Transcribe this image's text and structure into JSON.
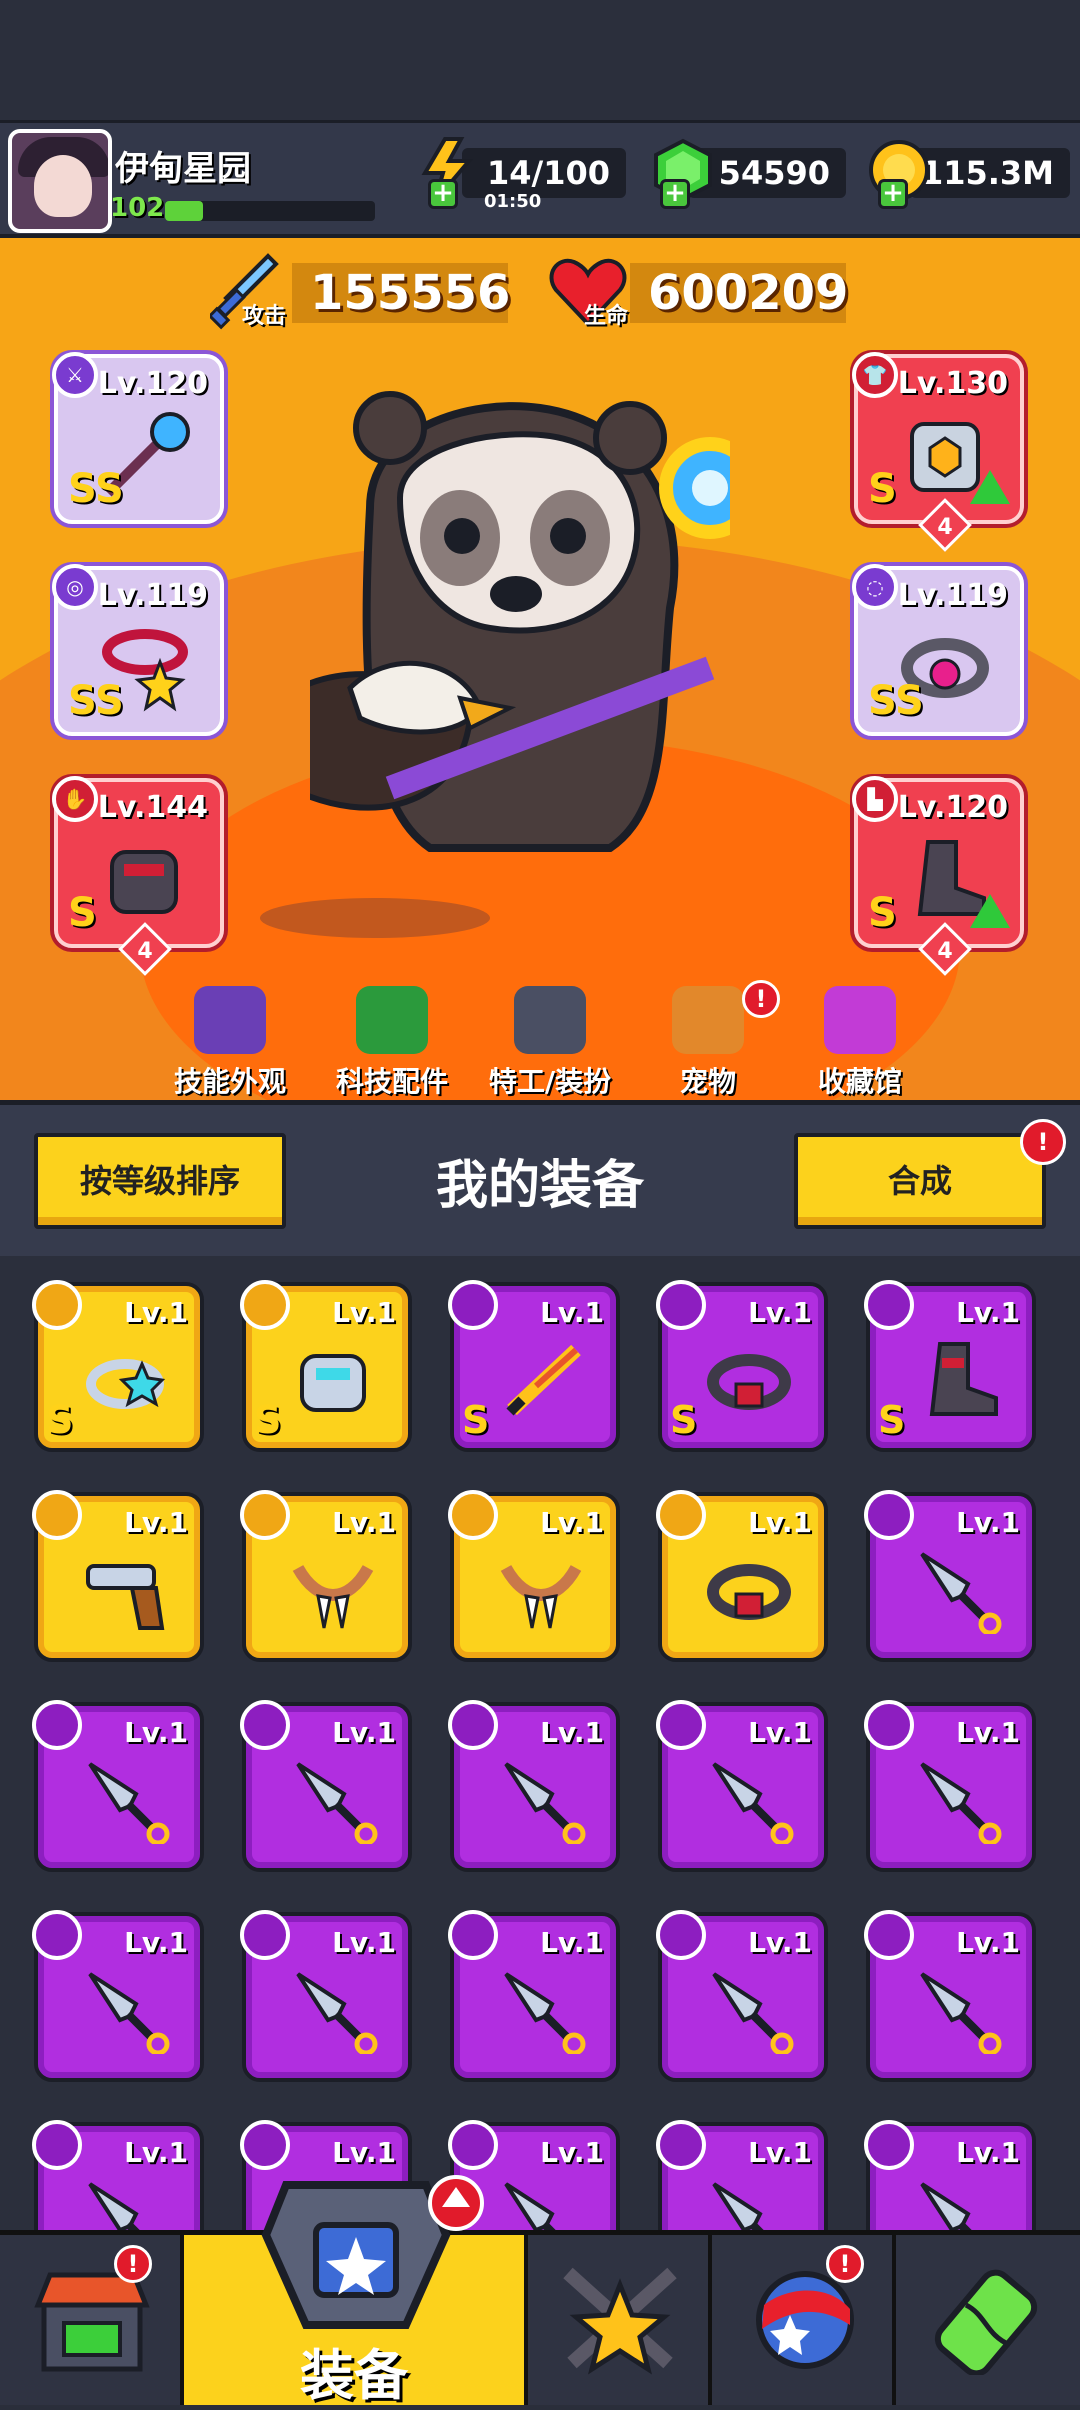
{
  "header": {
    "player_name": "伊甸星园",
    "level": "102",
    "xp_fraction": 0.18,
    "energy": "14/100",
    "energy_timer": "01:50",
    "gems": "54590",
    "coins": "115.3M"
  },
  "stats": {
    "attack_label": "攻击",
    "attack_value": "155556",
    "hp_label": "生命",
    "hp_value": "600209"
  },
  "slots": [
    {
      "id": "weapon",
      "level": "Lv.120",
      "grade": "SS",
      "rarity": "purple"
    },
    {
      "id": "necklace",
      "level": "Lv.119",
      "grade": "SS",
      "rarity": "purple"
    },
    {
      "id": "gloves",
      "level": "Lv.144",
      "grade": "S",
      "rarity": "red",
      "stars": "4"
    },
    {
      "id": "armor",
      "level": "Lv.130",
      "grade": "S",
      "rarity": "red",
      "stars": "4",
      "upgrade": true
    },
    {
      "id": "belt",
      "level": "Lv.119",
      "grade": "SS",
      "rarity": "purple"
    },
    {
      "id": "boots",
      "level": "Lv.120",
      "grade": "S",
      "rarity": "red",
      "stars": "4",
      "upgrade": true
    }
  ],
  "nav": [
    {
      "label": "技能外观",
      "color": "#6a3fb5",
      "badge": false
    },
    {
      "label": "科技配件",
      "color": "#2b9a3c",
      "badge": false
    },
    {
      "label": "特工/装扮",
      "color": "#4a4f63",
      "badge": false
    },
    {
      "label": "宠物",
      "color": "#e2882b",
      "badge": true
    },
    {
      "label": "收藏馆",
      "color": "#c23bd6",
      "badge": false
    }
  ],
  "equipment": {
    "sort_button": "按等级排序",
    "title": "我的装备",
    "merge_button": "合成",
    "merge_badge": "!"
  },
  "items": [
    {
      "rarity": "gold",
      "level": "Lv.1",
      "grade": "S",
      "art": "ring"
    },
    {
      "rarity": "gold",
      "level": "Lv.1",
      "grade": "S",
      "art": "gauntlet"
    },
    {
      "rarity": "violet",
      "level": "Lv.1",
      "grade": "S",
      "art": "sword"
    },
    {
      "rarity": "violet",
      "level": "Lv.1",
      "grade": "S",
      "art": "belt"
    },
    {
      "rarity": "violet",
      "level": "Lv.1",
      "grade": "S",
      "art": "boot"
    },
    {
      "rarity": "gold",
      "level": "Lv.1",
      "grade": "",
      "art": "revolver"
    },
    {
      "rarity": "gold",
      "level": "Lv.1",
      "grade": "",
      "art": "fang-necklace"
    },
    {
      "rarity": "gold",
      "level": "Lv.1",
      "grade": "",
      "art": "fang-necklace"
    },
    {
      "rarity": "gold",
      "level": "Lv.1",
      "grade": "",
      "art": "belt"
    },
    {
      "rarity": "violet",
      "level": "Lv.1",
      "grade": "",
      "art": "kunai"
    },
    {
      "rarity": "violet",
      "level": "Lv.1",
      "grade": "",
      "art": "kunai"
    },
    {
      "rarity": "violet",
      "level": "Lv.1",
      "grade": "",
      "art": "kunai"
    },
    {
      "rarity": "violet",
      "level": "Lv.1",
      "grade": "",
      "art": "kunai"
    },
    {
      "rarity": "violet",
      "level": "Lv.1",
      "grade": "",
      "art": "kunai"
    },
    {
      "rarity": "violet",
      "level": "Lv.1",
      "grade": "",
      "art": "kunai"
    },
    {
      "rarity": "violet",
      "level": "Lv.1",
      "grade": "",
      "art": "kunai"
    },
    {
      "rarity": "violet",
      "level": "Lv.1",
      "grade": "",
      "art": "kunai"
    },
    {
      "rarity": "violet",
      "level": "Lv.1",
      "grade": "",
      "art": "kunai"
    },
    {
      "rarity": "violet",
      "level": "Lv.1",
      "grade": "",
      "art": "kunai"
    },
    {
      "rarity": "violet",
      "level": "Lv.1",
      "grade": "",
      "art": "kunai"
    },
    {
      "rarity": "violet",
      "level": "Lv.1",
      "grade": "",
      "art": "kunai"
    },
    {
      "rarity": "violet",
      "level": "Lv.1",
      "grade": "",
      "art": "kunai"
    },
    {
      "rarity": "violet",
      "level": "Lv.1",
      "grade": "",
      "art": "kunai"
    },
    {
      "rarity": "violet",
      "level": "Lv.1",
      "grade": "",
      "art": "kunai"
    },
    {
      "rarity": "violet",
      "level": "Lv.1",
      "grade": "",
      "art": "kunai"
    }
  ],
  "tabs": [
    {
      "id": "shop",
      "label": "",
      "badge": true,
      "icon": "shop-icon"
    },
    {
      "id": "equipment",
      "label": "装备",
      "badge": true,
      "icon": "equipment-icon",
      "active": true
    },
    {
      "id": "battle",
      "label": "",
      "badge": false,
      "icon": "battle-icon"
    },
    {
      "id": "events",
      "label": "",
      "badge": true,
      "icon": "ball-icon"
    },
    {
      "id": "evolve",
      "label": "",
      "badge": false,
      "icon": "dna-icon"
    }
  ]
}
